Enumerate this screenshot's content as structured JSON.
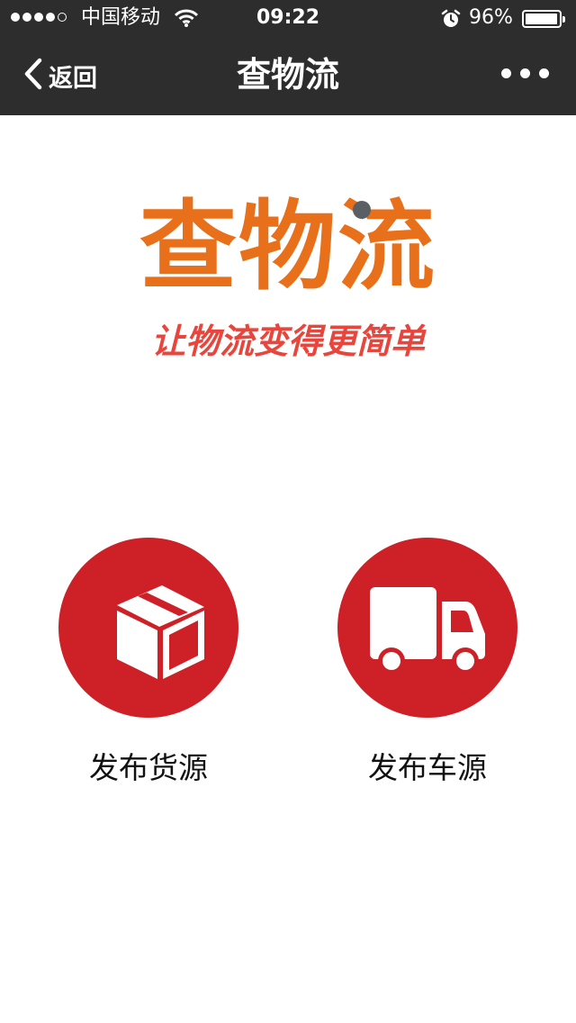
{
  "status_bar": {
    "carrier": "中国移动",
    "time": "09:22",
    "battery_percent": "96%",
    "battery_level": 0.96,
    "signal_bars": 4,
    "signal_max": 5,
    "icons": [
      "signal-dots-icon",
      "wifi-icon",
      "alarm-icon",
      "battery-icon"
    ]
  },
  "nav": {
    "back_label": "返回",
    "title": "查物流",
    "back_icon": "chevron-left-icon",
    "more_icon": "more-dots-icon"
  },
  "logo": {
    "text": "查物流",
    "slogan": "让物流变得更简单"
  },
  "actions": [
    {
      "label": "发布货源",
      "icon": "box-icon"
    },
    {
      "label": "发布车源",
      "icon": "truck-icon"
    }
  ],
  "colors": {
    "bar_background": "#2d2d2d",
    "brand_orange": "#e8701a",
    "slogan_red": "#e8453c",
    "action_red": "#cd2127",
    "page_background": "#ffffff"
  }
}
